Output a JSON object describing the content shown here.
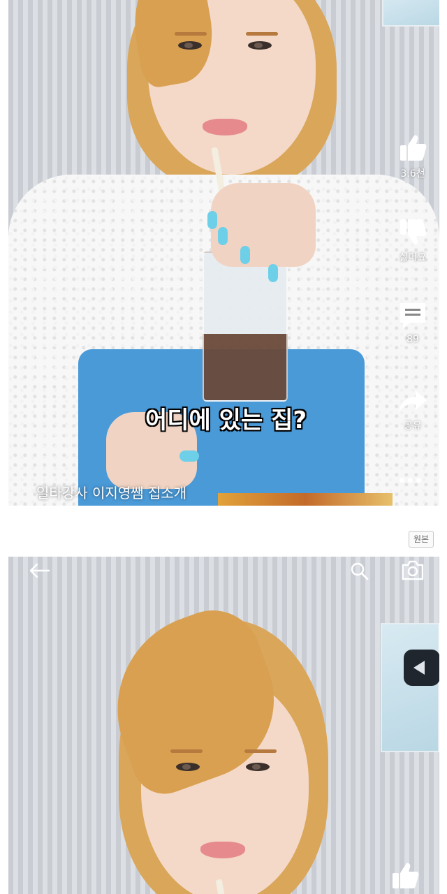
{
  "top_video": {
    "caption": "어디에 있는 집?",
    "title": "일타강사 이지영쌤 집소개",
    "actions": [
      {
        "name": "like",
        "icon": "thumbs-up-icon",
        "label": "3.6천"
      },
      {
        "name": "dislike",
        "icon": "thumbs-down-icon",
        "label": "싫어요"
      },
      {
        "name": "comments",
        "icon": "comment-icon",
        "label": "89"
      },
      {
        "name": "share",
        "icon": "share-icon",
        "label": "공유"
      },
      {
        "name": "more",
        "icon": "more-dots-icon",
        "label": ""
      }
    ]
  },
  "original_badge": "원본",
  "bottom_video": {
    "icons": [
      "back-arrow-icon",
      "search-icon",
      "camera-icon",
      "thumbs-up-icon"
    ]
  },
  "colors": {
    "page_background": "#ffffff",
    "dress_blue": "#4a9ad8",
    "nail_cyan": "#6ed0e8",
    "hair_blonde": "#d9a65a"
  }
}
